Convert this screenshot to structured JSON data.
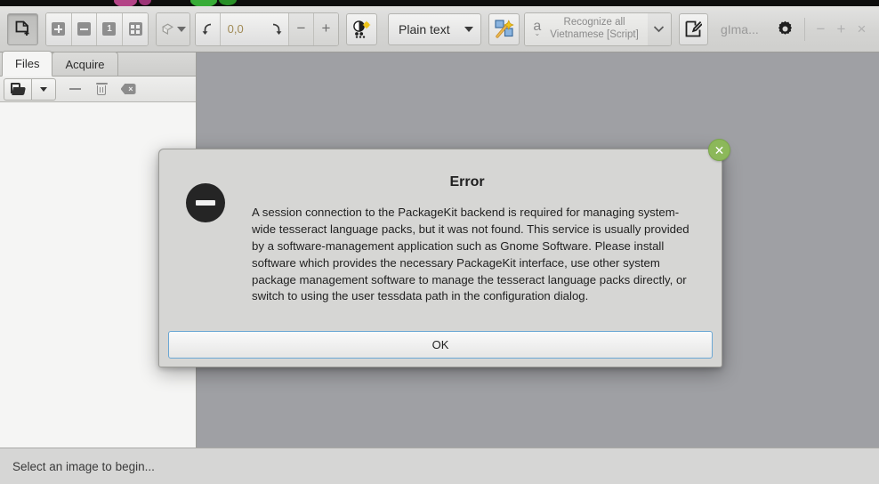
{
  "window": {
    "app_title": "gIma...",
    "minimize_label": "−",
    "maximize_label": "+",
    "close_label": "×"
  },
  "toolbar": {
    "add_images_label": "",
    "zoom_in_label": "",
    "zoom_out_label": "",
    "zoom_one_label": "1",
    "zoom_fit_label": "",
    "rotate_value": "0,0",
    "rotate_left_label": "↰",
    "rotate_right_label": "↳",
    "brightness_minus_label": "−",
    "brightness_plus_label": "+",
    "output_mode_label": "Plain text",
    "recognize_line1": "Recognize all",
    "recognize_line2": "Vietnamese [Script]",
    "recognize_a_glyph": "a",
    "settings_label": "",
    "edit_label": ""
  },
  "sidebar": {
    "tabs": [
      {
        "label": "Files",
        "selected": true
      },
      {
        "label": "Acquire",
        "selected": false
      }
    ],
    "toolbar_buttons": [
      {
        "name": "open-file-button"
      },
      {
        "name": "open-file-dropdown"
      },
      {
        "name": "remove-file-button"
      },
      {
        "name": "delete-file-button"
      },
      {
        "name": "clear-list-button"
      }
    ],
    "file_list": []
  },
  "statusbar": {
    "message": "Select an image to begin..."
  },
  "dialog": {
    "title": "Error",
    "message": "A session connection to the PackageKit backend is required for managing system-wide tesseract language packs, but it was not found. This service is usually provided by a software-management application such as Gnome Software. Please install software which provides the necessary PackageKit interface, use other system package management software to manage the tesseract language packs directly, or switch to using the user tessdata path in the configuration dialog.",
    "ok_label": "OK",
    "close_label": "✕"
  },
  "colors": {
    "canvas_gray": "#9fa0a4",
    "chrome_gray": "#d6d6d4",
    "dialog_focus_blue": "#6ba7d4",
    "close_green": "#8cb85a",
    "rotate_value_amber": "#a08a55"
  }
}
